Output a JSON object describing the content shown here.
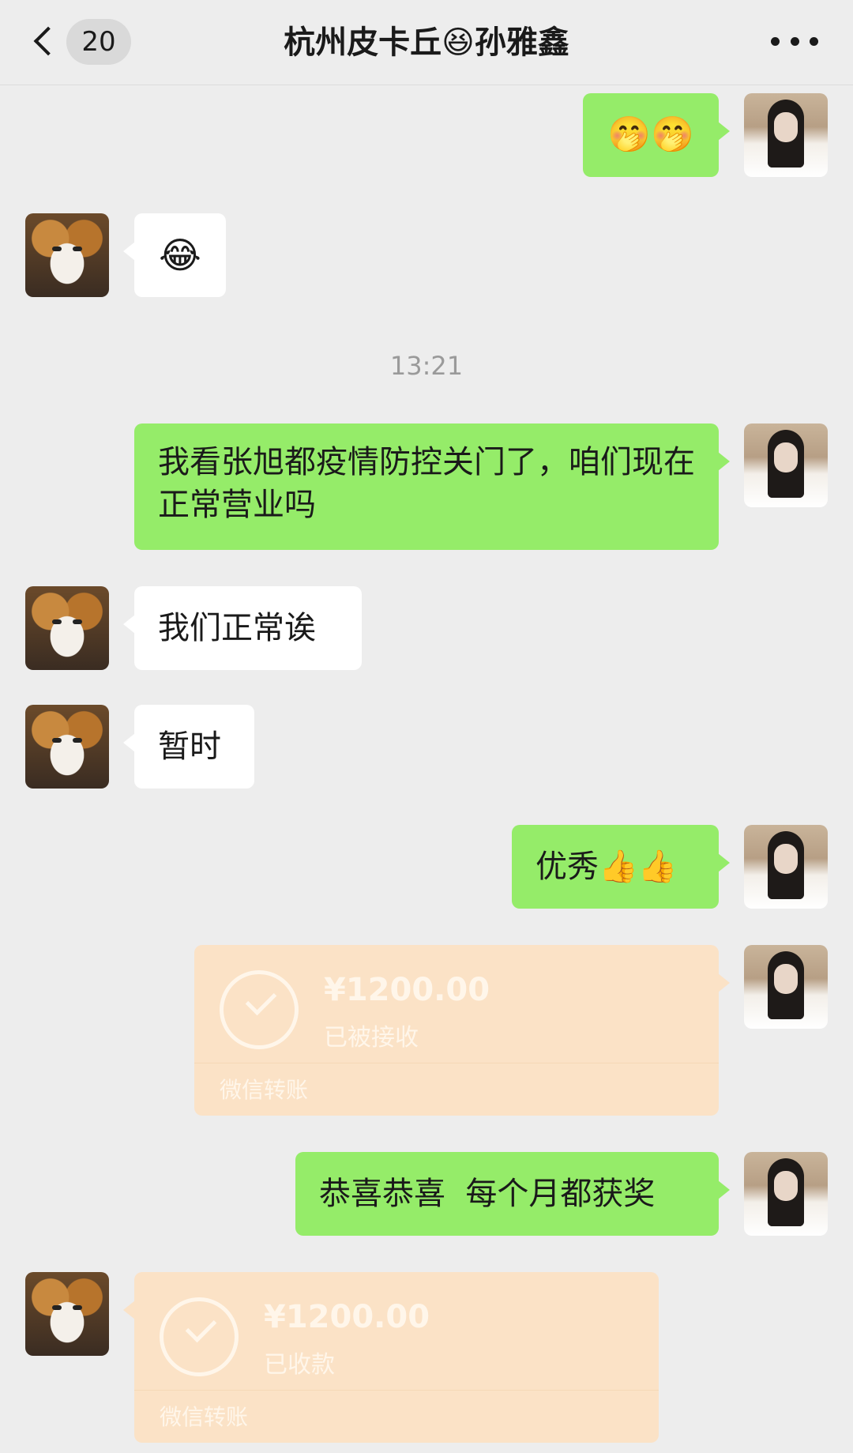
{
  "header": {
    "back_count": "20",
    "title": "杭州皮卡丘😆孙雅鑫"
  },
  "messages": {
    "m1": "🤭🤭",
    "m2": "😂",
    "time1": "13:21",
    "m3": "我看张旭都疫情防控关门了，咱们现在正常营业吗",
    "m4": "我们正常诶",
    "m5": "暂时",
    "m6": "优秀👍👍",
    "t1": {
      "amount": "¥1200.00",
      "status": "已被接收",
      "footer": "微信转账"
    },
    "m7": "恭喜恭喜  每个月都获奖",
    "t2": {
      "amount": "¥1200.00",
      "status": "已收款",
      "footer": "微信转账"
    }
  },
  "colors": {
    "background": "#ededed",
    "bubble_sent": "#95ec69",
    "bubble_received": "#ffffff",
    "transfer": "#fbe2c6"
  }
}
